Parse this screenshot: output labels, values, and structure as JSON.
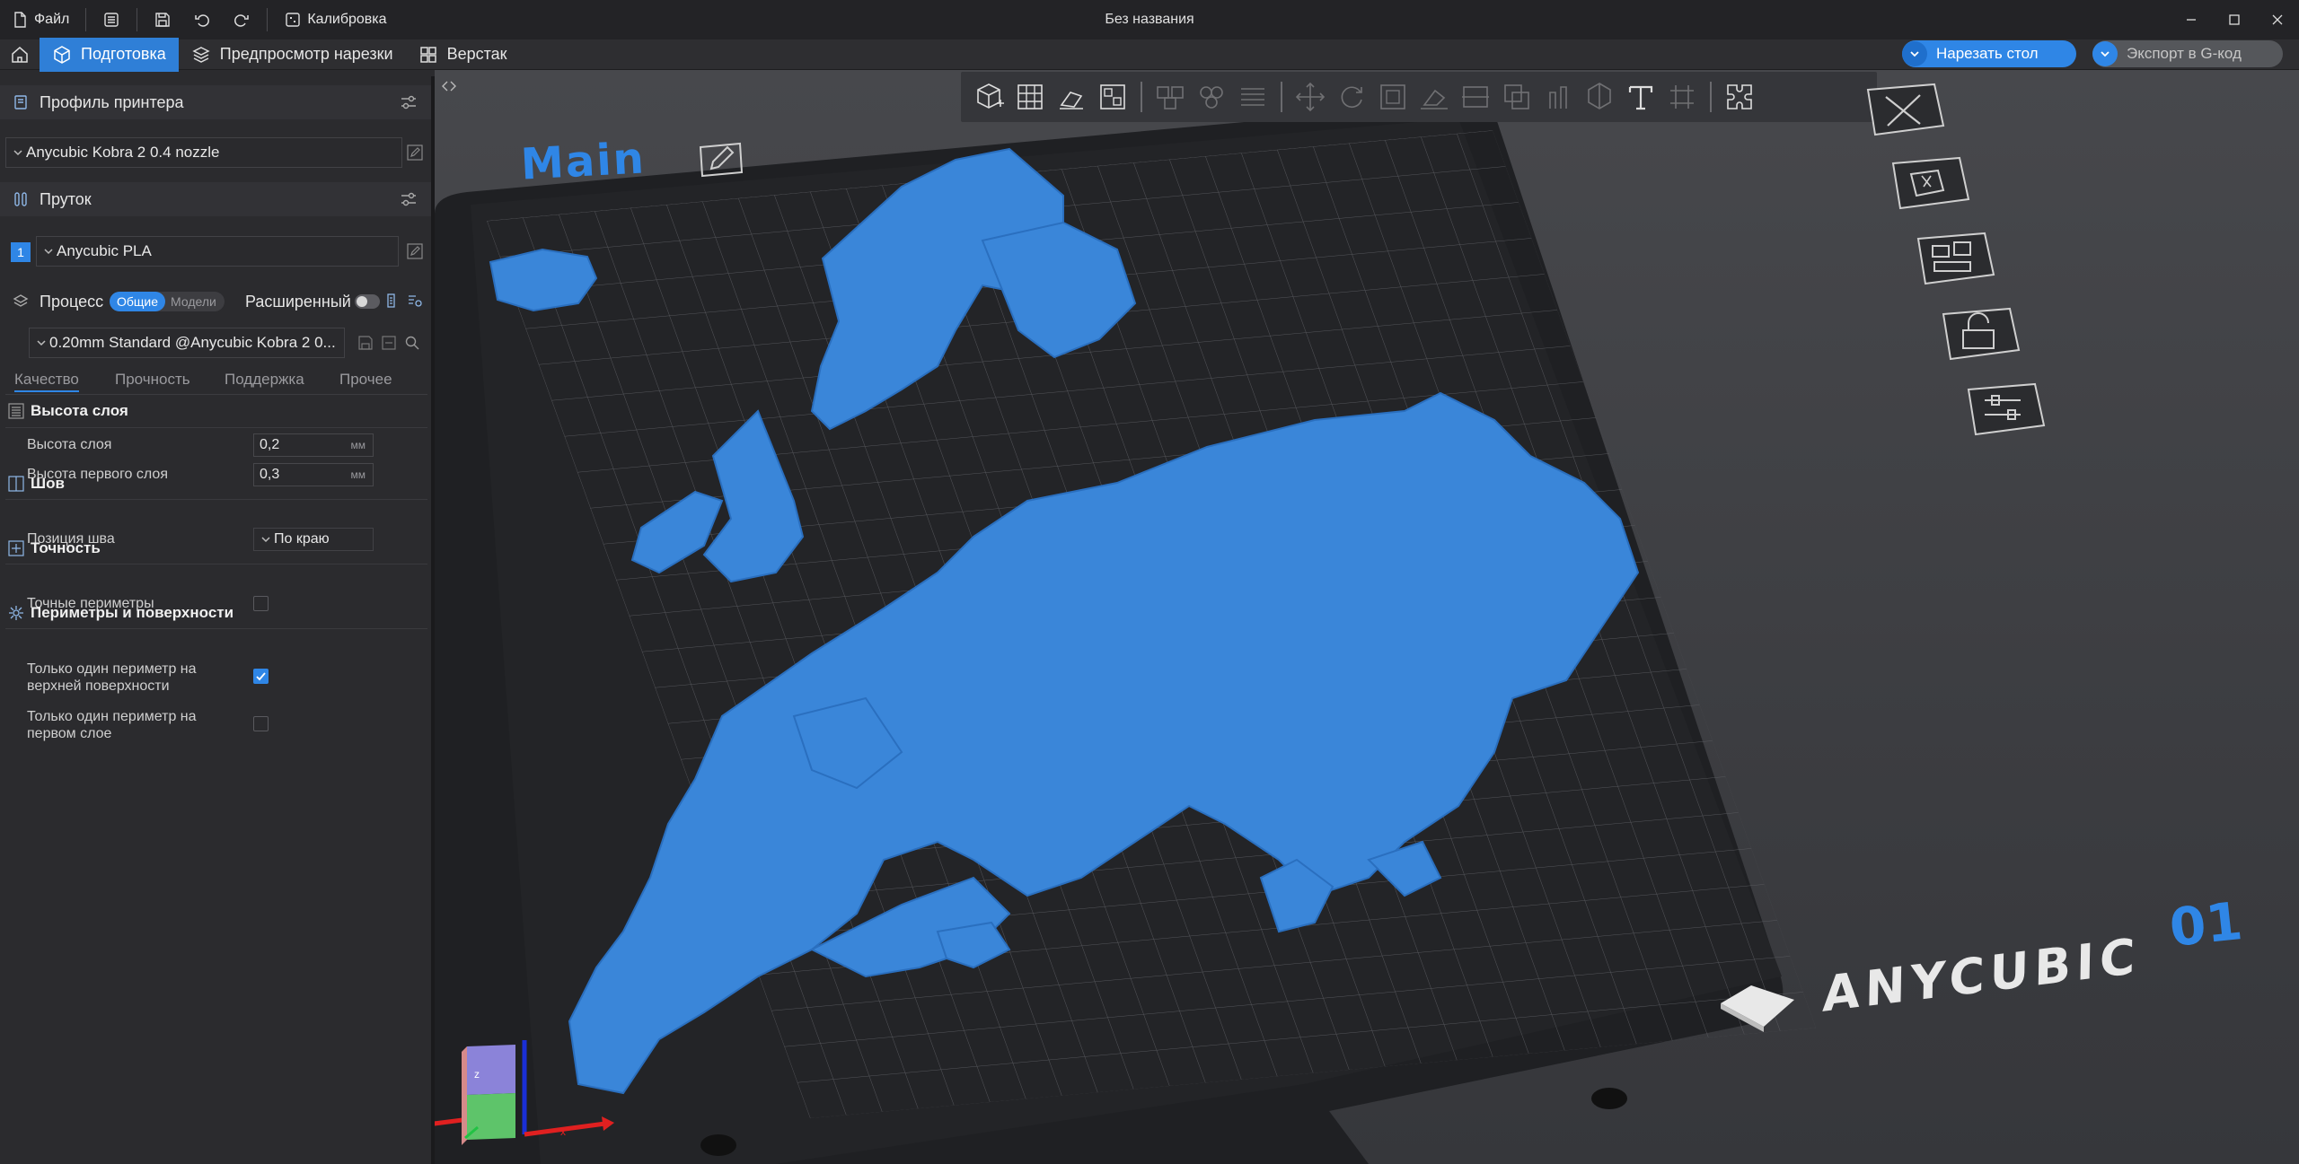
{
  "titlebar": {
    "file_label": "Файл",
    "calibration_label": "Калибровка",
    "window_title": "Без названия"
  },
  "tabs": [
    {
      "label": "Подготовка",
      "icon": "cube-icon",
      "active": true
    },
    {
      "label": "Предпросмотр нарезки",
      "icon": "layers-icon",
      "active": false
    },
    {
      "label": "Верстак",
      "icon": "grid-icon",
      "active": false
    }
  ],
  "actions": {
    "slice_label": "Нарезать стол",
    "export_label": "Экспорт в G-код"
  },
  "sidebar": {
    "printer": {
      "title": "Профиль принтера",
      "value": "Anycubic Kobra 2 0.4 nozzle"
    },
    "filament": {
      "title": "Пруток",
      "index": "1",
      "value": "Anycubic PLA"
    },
    "process": {
      "title": "Процесс",
      "toggle_on": "Общие",
      "toggle_off": "Модели",
      "advanced_label": "Расширенный",
      "value": "0.20mm Standard @Anycubic Kobra 2 0..."
    },
    "subtabs": [
      "Качество",
      "Прочность",
      "Поддержка",
      "Прочее"
    ],
    "groups": {
      "layer_height": {
        "title": "Высота слоя",
        "params": [
          {
            "label": "Высота слоя",
            "value": "0,2",
            "unit": "мм"
          },
          {
            "label": "Высота первого слоя",
            "value": "0,3",
            "unit": "мм"
          }
        ]
      },
      "seam": {
        "title": "Шов",
        "position_label": "Позиция шва",
        "position_value": "По краю"
      },
      "precision": {
        "title": "Точность",
        "precise_walls_label": "Точные периметры",
        "precise_walls_checked": false
      },
      "walls": {
        "title": "Периметры и поверхности",
        "one_wall_top_label_1": "Только один периметр на",
        "one_wall_top_label_2": "верхней поверхности",
        "one_wall_top_checked": true,
        "one_wall_first_label_1": "Только один периметр на",
        "one_wall_first_label_2": "первом слое",
        "one_wall_first_checked": false
      }
    }
  },
  "viewport": {
    "plate_name": "Main",
    "bed_number": "01",
    "brand": "ANYCUBIC",
    "axis_z": "z",
    "axis_x": "x",
    "model_color": "#3a86d9",
    "accent_color": "#2f86e6"
  }
}
